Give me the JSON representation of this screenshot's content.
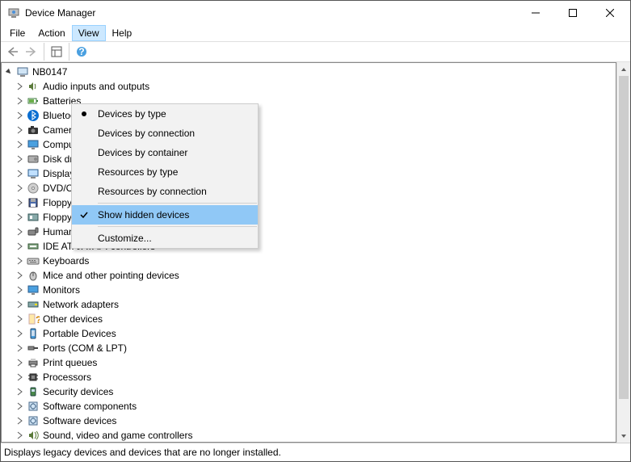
{
  "title": "Device Manager",
  "menubar": {
    "file": "File",
    "action": "Action",
    "view": "View",
    "help": "Help"
  },
  "dropdown": {
    "by_type": "Devices by type",
    "by_connection": "Devices by connection",
    "by_container": "Devices by container",
    "res_by_type": "Resources by type",
    "res_by_connection": "Resources by connection",
    "show_hidden": "Show hidden devices",
    "customize": "Customize..."
  },
  "tree": {
    "root": "NB0147",
    "nodes": [
      "Audio inputs and outputs",
      "Batteries",
      "Bluetooth",
      "Cameras",
      "Computer",
      "Disk drives",
      "Display adapters",
      "DVD/CD-ROM drives",
      "Floppy disk drives",
      "Floppy drive controllers",
      "Human Interface Devices",
      "IDE ATA/ATAPI controllers",
      "Keyboards",
      "Mice and other pointing devices",
      "Monitors",
      "Network adapters",
      "Other devices",
      "Portable Devices",
      "Ports (COM & LPT)",
      "Print queues",
      "Processors",
      "Security devices",
      "Software components",
      "Software devices",
      "Sound, video and game controllers"
    ]
  },
  "icons": {
    "n0": "speaker-icon",
    "n1": "battery-icon",
    "n2": "bluetooth-icon",
    "n3": "camera-icon",
    "n4": "monitor-icon",
    "n5": "disk-icon",
    "n6": "display-adapter-icon",
    "n7": "dvd-icon",
    "n8": "floppy-icon",
    "n9": "floppy-controller-icon",
    "n10": "hid-icon",
    "n11": "ide-icon",
    "n12": "keyboard-icon",
    "n13": "mouse-icon",
    "n14": "monitor-icon",
    "n15": "network-icon",
    "n16": "question-icon",
    "n17": "portable-icon",
    "n18": "ports-icon",
    "n19": "printer-icon",
    "n20": "processor-icon",
    "n21": "security-icon",
    "n22": "software-icon",
    "n23": "software-icon",
    "n24": "sound-icon"
  },
  "statusbar": "Displays legacy devices and devices that are no longer installed."
}
